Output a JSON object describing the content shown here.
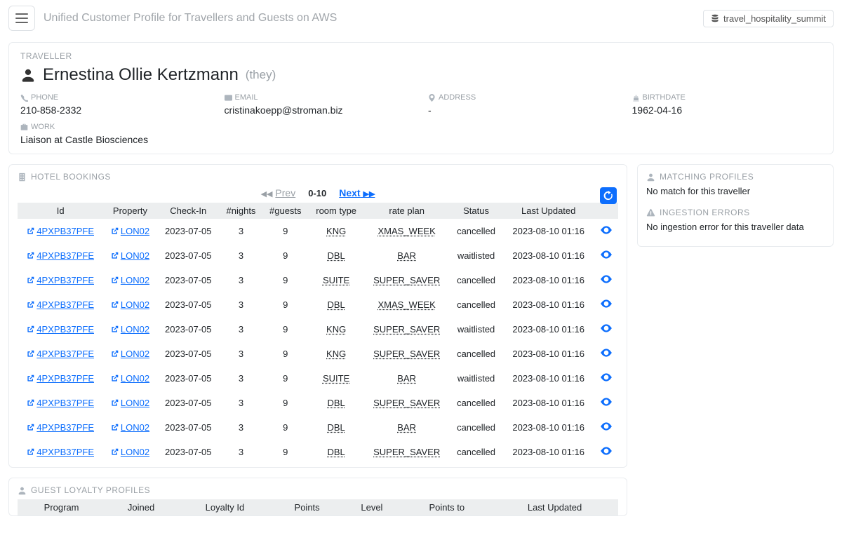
{
  "header": {
    "app_title": "Unified Customer Profile for Travellers and Guests on AWS",
    "domain_badge": "travel_hospitality_summit"
  },
  "traveller": {
    "section_label": "TRAVELLER",
    "name": "Ernestina Ollie Kertzmann",
    "pronoun": "(they)",
    "fields": {
      "phone_label": "PHONE",
      "phone_value": "210-858-2332",
      "email_label": "EMAIL",
      "email_value": "cristinakoepp@stroman.biz",
      "address_label": "ADDRESS",
      "address_value": "-",
      "birthdate_label": "BIRTHDATE",
      "birthdate_value": "1962-04-16",
      "work_label": "WORK",
      "work_value": "Liaison at Castle Biosciences"
    }
  },
  "bookings": {
    "section_label": "HOTEL BOOKINGS",
    "pager": {
      "prev": "Prev",
      "range": "0-10",
      "next": "Next"
    },
    "columns": [
      "Id",
      "Property",
      "Check-In",
      "#nights",
      "#guests",
      "room type",
      "rate plan",
      "Status",
      "Last Updated",
      ""
    ],
    "rows": [
      {
        "id": "4PXPB37PFE",
        "property": "LON02",
        "checkin": "2023-07-05",
        "nights": "3",
        "guests": "9",
        "room": "KNG",
        "rate": "XMAS_WEEK",
        "status": "cancelled",
        "updated": "2023-08-10 01:16"
      },
      {
        "id": "4PXPB37PFE",
        "property": "LON02",
        "checkin": "2023-07-05",
        "nights": "3",
        "guests": "9",
        "room": "DBL",
        "rate": "BAR",
        "status": "waitlisted",
        "updated": "2023-08-10 01:16"
      },
      {
        "id": "4PXPB37PFE",
        "property": "LON02",
        "checkin": "2023-07-05",
        "nights": "3",
        "guests": "9",
        "room": "SUITE",
        "rate": "SUPER_SAVER",
        "status": "cancelled",
        "updated": "2023-08-10 01:16"
      },
      {
        "id": "4PXPB37PFE",
        "property": "LON02",
        "checkin": "2023-07-05",
        "nights": "3",
        "guests": "9",
        "room": "DBL",
        "rate": "XMAS_WEEK",
        "status": "cancelled",
        "updated": "2023-08-10 01:16"
      },
      {
        "id": "4PXPB37PFE",
        "property": "LON02",
        "checkin": "2023-07-05",
        "nights": "3",
        "guests": "9",
        "room": "KNG",
        "rate": "SUPER_SAVER",
        "status": "waitlisted",
        "updated": "2023-08-10 01:16"
      },
      {
        "id": "4PXPB37PFE",
        "property": "LON02",
        "checkin": "2023-07-05",
        "nights": "3",
        "guests": "9",
        "room": "KNG",
        "rate": "SUPER_SAVER",
        "status": "cancelled",
        "updated": "2023-08-10 01:16"
      },
      {
        "id": "4PXPB37PFE",
        "property": "LON02",
        "checkin": "2023-07-05",
        "nights": "3",
        "guests": "9",
        "room": "SUITE",
        "rate": "BAR",
        "status": "waitlisted",
        "updated": "2023-08-10 01:16"
      },
      {
        "id": "4PXPB37PFE",
        "property": "LON02",
        "checkin": "2023-07-05",
        "nights": "3",
        "guests": "9",
        "room": "DBL",
        "rate": "SUPER_SAVER",
        "status": "cancelled",
        "updated": "2023-08-10 01:16"
      },
      {
        "id": "4PXPB37PFE",
        "property": "LON02",
        "checkin": "2023-07-05",
        "nights": "3",
        "guests": "9",
        "room": "DBL",
        "rate": "BAR",
        "status": "cancelled",
        "updated": "2023-08-10 01:16"
      },
      {
        "id": "4PXPB37PFE",
        "property": "LON02",
        "checkin": "2023-07-05",
        "nights": "3",
        "guests": "9",
        "room": "DBL",
        "rate": "SUPER_SAVER",
        "status": "cancelled",
        "updated": "2023-08-10 01:16"
      }
    ]
  },
  "loyalty": {
    "section_label": "GUEST LOYALTY PROFILES",
    "columns": [
      "Program",
      "Joined",
      "Loyalty Id",
      "Points",
      "Level",
      "Points to",
      "Last Updated"
    ]
  },
  "sidebar": {
    "matching_label": "MATCHING PROFILES",
    "matching_body": "No match for this traveller",
    "ingestion_label": "INGESTION ERRORS",
    "ingestion_body": "No ingestion error for this traveller data"
  }
}
